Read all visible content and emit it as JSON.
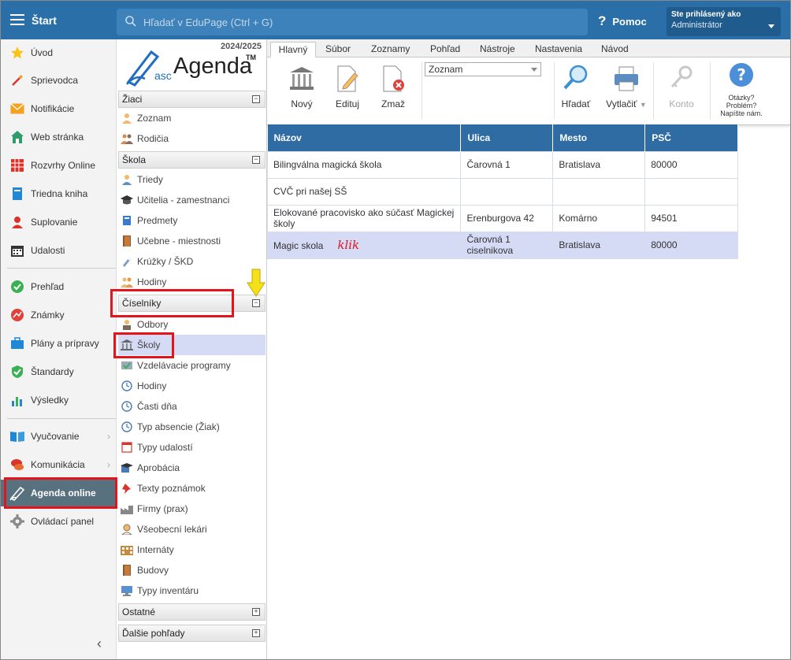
{
  "topbar": {
    "start_label": "Štart",
    "search_placeholder": "Hľadať v EduPage (Ctrl + G)",
    "help_label": "Pomoc",
    "user_line1": "Ste prihlásený ako",
    "user_line2": "Administrátor"
  },
  "leftnav": {
    "items": [
      {
        "label": "Úvod",
        "icon": "star-icon"
      },
      {
        "label": "Sprievodca",
        "icon": "wand-icon"
      },
      {
        "label": "Notifikácie",
        "icon": "envelope-icon"
      },
      {
        "label": "Web stránka",
        "icon": "house-icon"
      },
      {
        "label": "Rozvrhy Online",
        "icon": "grid-icon"
      },
      {
        "label": "Triedna kniha",
        "icon": "book-icon"
      },
      {
        "label": "Suplovanie",
        "icon": "person-icon"
      },
      {
        "label": "Udalosti",
        "icon": "calendar-icon"
      },
      {
        "label": "Prehľad",
        "icon": "check-circle-icon"
      },
      {
        "label": "Známky",
        "icon": "chart-circle-icon"
      },
      {
        "label": "Plány a prípravy",
        "icon": "briefcase-icon"
      },
      {
        "label": "Štandardy",
        "icon": "shield-check-icon"
      },
      {
        "label": "Výsledky",
        "icon": "bar-chart-icon"
      },
      {
        "label": "Vyučovanie",
        "icon": "open-book-icon"
      },
      {
        "label": "Komunikácia",
        "icon": "chat-icon"
      },
      {
        "label": "Agenda online",
        "icon": "pen-icon"
      },
      {
        "label": "Ovládací panel",
        "icon": "gear-icon"
      }
    ]
  },
  "midnav": {
    "year": "2024/2025",
    "logo_asc": "asc",
    "logo_agenda": "Agenda",
    "logo_tm": "TM",
    "sections": {
      "ziaci": "Žiaci",
      "skola": "Škola",
      "ciselniky": "Číselníky",
      "ostatne": "Ostatné",
      "dalsie": "Ďalšie pohľady"
    },
    "ziaci_items": [
      "Zoznam",
      "Rodičia"
    ],
    "skola_items": [
      "Triedy",
      "Učitelia - zamestnanci",
      "Predmety",
      "Učebne - miestnosti",
      "Krúžky / ŠKD",
      "Hodiny"
    ],
    "ciselniky_items": [
      "Odbory",
      "Školy",
      "Vzdelávacie programy",
      "Hodiny",
      "Časti dňa",
      "Typ absencie (Žiak)",
      "Typy udalostí",
      "Aprobácia",
      "Texty poznámok",
      "Firmy (prax)",
      "Všeobecní lekári",
      "Internáty",
      "Budovy",
      "Typy inventáru"
    ],
    "toggle_minus": "−",
    "toggle_plus": "+"
  },
  "ribbon": {
    "tabs": [
      "Hlavný",
      "Súbor",
      "Zoznamy",
      "Pohľad",
      "Nástroje",
      "Nastavenia",
      "Návod"
    ],
    "btn_new": "Nový",
    "btn_edit": "Edituj",
    "btn_delete": "Zmaž",
    "dropdown_value": "Zoznam",
    "btn_search": "Hľadať",
    "btn_print": "Vytlačiť",
    "btn_account": "Konto",
    "help_line1": "Otázky?",
    "help_line2": "Problém?",
    "help_line3": "Napíšte nám."
  },
  "table": {
    "headers": [
      "Názov",
      "Ulica",
      "Mesto",
      "PSČ"
    ],
    "rows": [
      {
        "nazov": "Bilingválna magická škola",
        "ulica": "Čarovná 1",
        "mesto": "Bratislava",
        "psc": "80000"
      },
      {
        "nazov": "CVČ pri našej SŠ",
        "ulica": "",
        "mesto": "",
        "psc": ""
      },
      {
        "nazov": "Elokované pracovisko ako súčasť Magickej školy",
        "ulica": "Erenburgova 42",
        "mesto": "Komárno",
        "psc": "94501"
      },
      {
        "nazov": "Magic skola",
        "ulica": "Čarovná 1 ciselnikova",
        "mesto": "Bratislava",
        "psc": "80000"
      }
    ],
    "annotation": "klik"
  },
  "colors": {
    "topbar": "#2a6fa8",
    "table_header": "#2e6ca3",
    "selection": "#d5daf5",
    "annotation_red": "#e4141d",
    "arrow_yellow": "#f5e11a"
  }
}
